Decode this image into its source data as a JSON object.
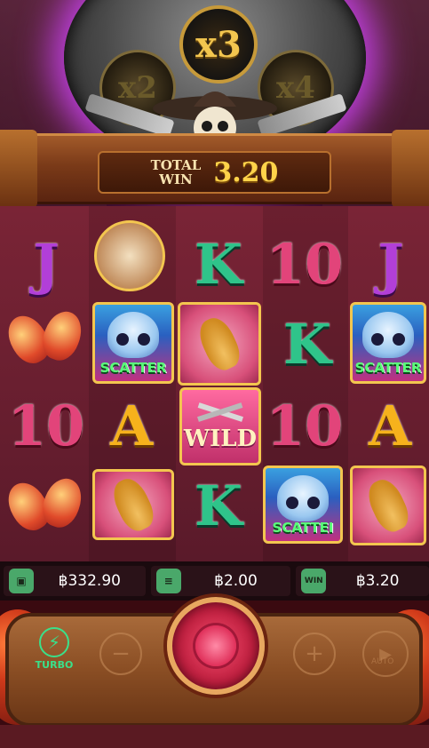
{
  "multipliers": {
    "left": "x2",
    "center": "x3",
    "right": "x4"
  },
  "win": {
    "label_line1": "TOTAL",
    "label_line2": "WIN",
    "value": "3.20"
  },
  "reels": {
    "letters": {
      "J": "J",
      "K": "K",
      "ten": "10",
      "A": "A"
    },
    "scatter_text": "SCATTER",
    "scatter_text_cut": "SCATTEI",
    "wild_text": "WILD"
  },
  "info": {
    "balance": "฿332.90",
    "bet": "฿2.00",
    "win": "฿3.20",
    "win_icon_label": "WIN"
  },
  "controls": {
    "turbo_label": "TURBO",
    "minus_label": "−",
    "plus_label": "+",
    "auto_label": "AUTO"
  },
  "colors": {
    "accent": "#ffd34a",
    "turbo": "#3ae08a",
    "spin": "#c02040"
  }
}
